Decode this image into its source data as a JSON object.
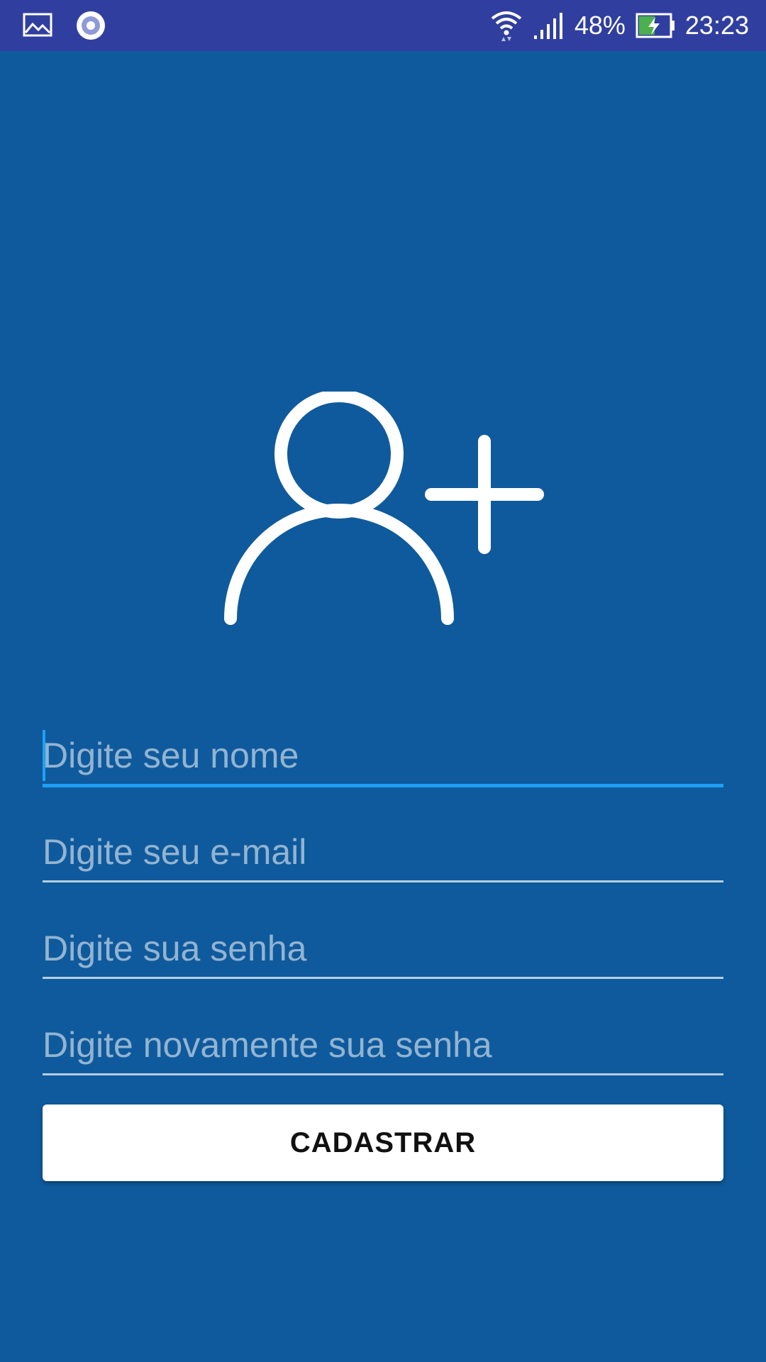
{
  "status_bar": {
    "battery_percent": "48%",
    "time": "23:23",
    "icons": [
      "gallery-icon",
      "record-icon",
      "wifi-icon",
      "signal-icon",
      "battery-charging-icon"
    ],
    "background_color": "#303f9f"
  },
  "screen": {
    "background_color": "#0f5a9c",
    "hero_icon": "add-user-icon"
  },
  "form": {
    "name_placeholder": "Digite seu nome",
    "email_placeholder": "Digite seu e-mail",
    "password_placeholder": "Digite sua senha",
    "confirm_password_placeholder": "Digite novamente sua senha",
    "submit_label": "CADASTRAR",
    "accent_color": "#1ea0f5"
  }
}
